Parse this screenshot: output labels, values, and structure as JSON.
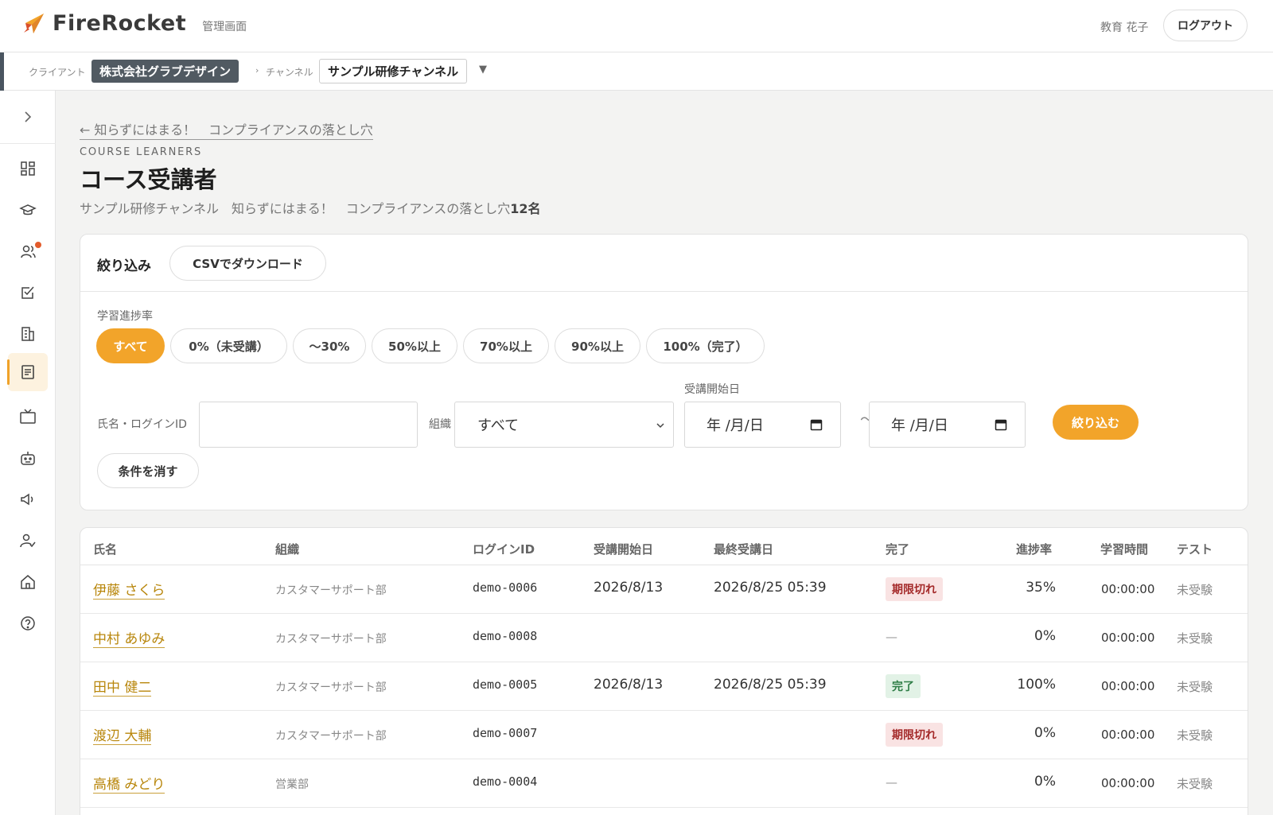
{
  "header": {
    "brand": "FireRocket",
    "brand_sub": "管理画面",
    "user_name": "教育 花子",
    "logout_label": "ログアウト"
  },
  "breadcrumb": {
    "client_label": "クライアント",
    "client_value": "株式会社グラブデザイン",
    "separator": "›",
    "channel_label": "チャンネル",
    "channel_value": "サンプル研修チャンネル",
    "channel_caret": "▼"
  },
  "sidebar": {
    "items": [
      {
        "name": "dashboard-icon"
      },
      {
        "name": "graduation-cap-icon"
      },
      {
        "name": "users-icon",
        "notification": true
      },
      {
        "name": "checkbox-icon"
      },
      {
        "name": "building-icon"
      },
      {
        "name": "document-icon",
        "active": true
      },
      {
        "name": "tv-icon"
      },
      {
        "name": "robot-icon"
      },
      {
        "name": "megaphone-icon"
      },
      {
        "name": "user-check-icon"
      },
      {
        "name": "home-icon"
      },
      {
        "name": "help-icon"
      }
    ]
  },
  "page": {
    "back_link": "← 知らずにはまる！　コンプライアンスの落とし穴",
    "eyebrow": "COURSE LEARNERS",
    "title": "コース受講者",
    "subtitle_text": "サンプル研修チャンネル　知らずにはまる！　コンプライアンスの落とし穴",
    "subtitle_count": "12名"
  },
  "filter": {
    "title": "絞り込み",
    "csv_label": "CSVでダウンロード",
    "progress_label": "学習進捗率",
    "progress_options": [
      "すべて",
      "0%（未受講）",
      "〜30%",
      "50%以上",
      "70%以上",
      "90%以上",
      "100%（完了）"
    ],
    "progress_selected": "すべて",
    "name_label": "氏名・ログインID",
    "name_value": "",
    "org_label": "組織",
    "org_value": "すべて",
    "start_date_label": "受講開始日",
    "date_placeholder": "年 /月/日",
    "tilde": "〜",
    "apply_label": "絞り込む",
    "clear_label": "条件を消す"
  },
  "table": {
    "columns": [
      "氏名",
      "組織",
      "ログインID",
      "受講開始日",
      "最終受講日",
      "完了",
      "進捗率",
      "学習時間",
      "テスト"
    ],
    "rows": [
      {
        "name": "伊藤 さくら",
        "org": "カスタマーサポート部",
        "login_id": "demo-0006",
        "start": "2026/8/13",
        "last": "2026/8/25 05:39",
        "status": "期限切れ",
        "status_type": "expired",
        "progress": "35%",
        "time": "00:00:00",
        "test": "未受験"
      },
      {
        "name": "中村 あゆみ",
        "org": "カスタマーサポート部",
        "login_id": "demo-0008",
        "start": "",
        "last": "",
        "status": "—",
        "status_type": "none",
        "progress": "0%",
        "time": "00:00:00",
        "test": "未受験"
      },
      {
        "name": "田中 健二",
        "org": "カスタマーサポート部",
        "login_id": "demo-0005",
        "start": "2026/8/13",
        "last": "2026/8/25 05:39",
        "status": "完了",
        "status_type": "done",
        "progress": "100%",
        "time": "00:00:00",
        "test": "未受験"
      },
      {
        "name": "渡辺 大輔",
        "org": "カスタマーサポート部",
        "login_id": "demo-0007",
        "start": "",
        "last": "",
        "status": "期限切れ",
        "status_type": "expired",
        "progress": "0%",
        "time": "00:00:00",
        "test": "未受験"
      },
      {
        "name": "高橋 みどり",
        "org": "営業部",
        "login_id": "demo-0004",
        "start": "",
        "last": "",
        "status": "—",
        "status_type": "none",
        "progress": "0%",
        "time": "00:00:00",
        "test": "未受験"
      }
    ]
  },
  "colors": {
    "accent": "#f2a42a",
    "link": "#b8860b",
    "expired_bg": "#f9e3e3",
    "done_bg": "#e2f2e6"
  }
}
